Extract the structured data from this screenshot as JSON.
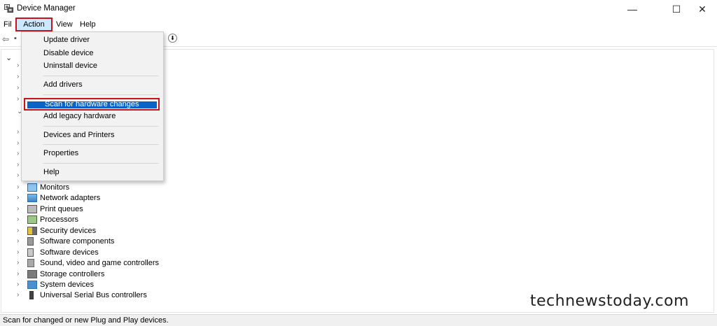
{
  "window": {
    "title": "Device Manager",
    "icon": "device-manager-icon",
    "controls": {
      "minimize": "—",
      "maximize": "☐",
      "close": "✕"
    }
  },
  "menubar": {
    "file": "File",
    "action": "Action",
    "view": "View",
    "help": "Help"
  },
  "toolbar": {
    "back_icon": "back-arrow-icon",
    "download_icon": "update-arrow-icon"
  },
  "action_menu": {
    "items": [
      {
        "label": "Update driver"
      },
      {
        "label": "Disable device"
      },
      {
        "label": "Uninstall device"
      },
      {
        "label": "Add drivers"
      },
      {
        "label": "Scan for hardware changes",
        "highlighted": true
      },
      {
        "label": "Add legacy hardware"
      },
      {
        "label": "Devices and Printers"
      },
      {
        "label": "Properties"
      },
      {
        "label": "Help"
      }
    ]
  },
  "tree": {
    "items": [
      {
        "label": "Monitors",
        "icon": "monitor-icon"
      },
      {
        "label": "Network adapters",
        "icon": "network-adapter-icon"
      },
      {
        "label": "Print queues",
        "icon": "printer-icon"
      },
      {
        "label": "Processors",
        "icon": "processor-icon"
      },
      {
        "label": "Security devices",
        "icon": "security-device-icon"
      },
      {
        "label": "Software components",
        "icon": "software-component-icon"
      },
      {
        "label": "Software devices",
        "icon": "software-device-icon"
      },
      {
        "label": "Sound, video and game controllers",
        "icon": "speaker-icon"
      },
      {
        "label": "Storage controllers",
        "icon": "storage-controller-icon"
      },
      {
        "label": "System devices",
        "icon": "system-device-icon"
      },
      {
        "label": "Universal Serial Bus controllers",
        "icon": "usb-icon"
      }
    ]
  },
  "statusbar": {
    "text": "Scan for changed or new Plug and Play devices."
  },
  "watermark": {
    "text": "technewstoday.com"
  },
  "colors": {
    "highlight": "#0a64c8",
    "annotation_red": "#c4151c",
    "menu_active": "#cce8ff"
  }
}
